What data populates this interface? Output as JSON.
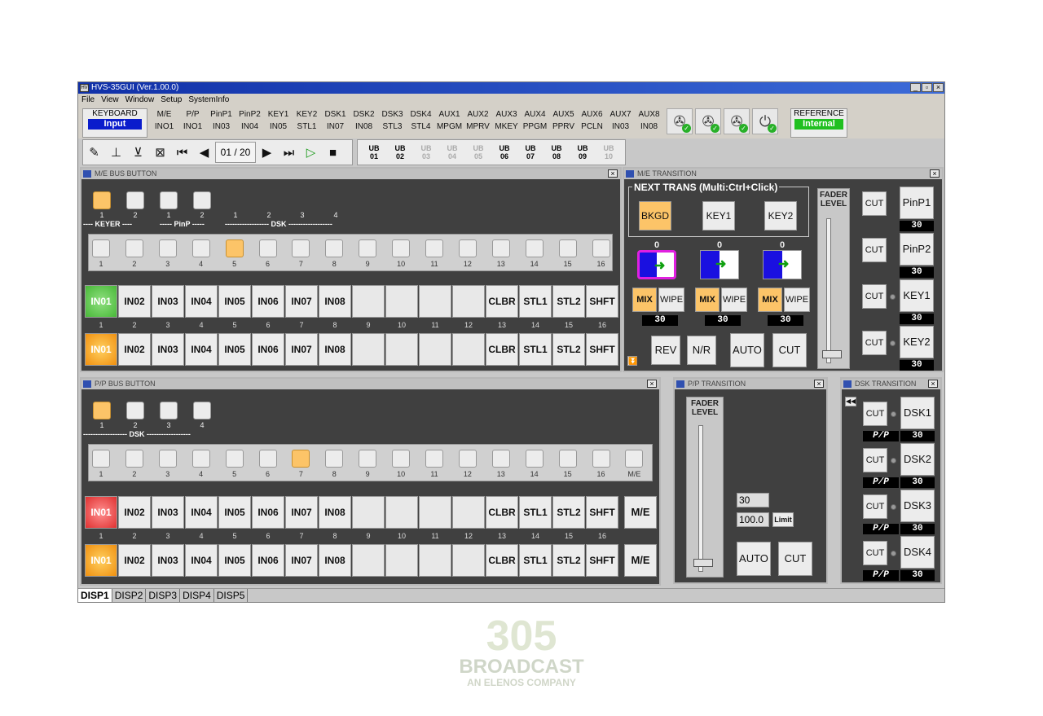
{
  "app": {
    "title": "HVS-35GUI (Ver.1.00.0)"
  },
  "menu": [
    "File",
    "View",
    "Window",
    "Setup",
    "SystemInfo"
  ],
  "keyboard": {
    "label": "KEYBOARD",
    "value": "Input"
  },
  "columns": [
    [
      "M/E",
      "INO1"
    ],
    [
      "P/P",
      "INO1"
    ],
    [
      "PinP1",
      "IN03"
    ],
    [
      "PinP2",
      "IN04"
    ],
    [
      "KEY1",
      "IN05"
    ],
    [
      "KEY2",
      "STL1"
    ],
    [
      "DSK1",
      "IN07"
    ],
    [
      "DSK2",
      "IN08"
    ],
    [
      "DSK3",
      "STL3"
    ],
    [
      "DSK4",
      "STL4"
    ],
    [
      "AUX1",
      "MPGM"
    ],
    [
      "AUX2",
      "MPRV"
    ],
    [
      "AUX3",
      "MKEY"
    ],
    [
      "AUX4",
      "PPGM"
    ],
    [
      "AUX5",
      "PPRV"
    ],
    [
      "AUX6",
      "PCLN"
    ],
    [
      "AUX7",
      "IN03"
    ],
    [
      "AUX8",
      "IN08"
    ]
  ],
  "status_icons": [
    "fan-icon",
    "fan-icon",
    "fan-icon",
    "power-icon"
  ],
  "reference": {
    "label": "REFERENCE",
    "value": "Internal"
  },
  "toolbar": {
    "counter": "01 / 20",
    "ub": [
      [
        "UB",
        "01",
        true
      ],
      [
        "UB",
        "02",
        true
      ],
      [
        "UB",
        "03",
        false
      ],
      [
        "UB",
        "04",
        false
      ],
      [
        "UB",
        "05",
        false
      ],
      [
        "UB",
        "06",
        true
      ],
      [
        "UB",
        "07",
        true
      ],
      [
        "UB",
        "08",
        true
      ],
      [
        "UB",
        "09",
        true
      ],
      [
        "UB",
        "10",
        false
      ]
    ]
  },
  "me_bus": {
    "title": "M/E BUS BUTTON",
    "keyer_nums": [
      "1",
      "2",
      "1",
      "2",
      "1",
      "2",
      "3",
      "4"
    ],
    "keyer_label": "---- KEYER ----",
    "pinp_label": "----- PinP -----",
    "dsk_label": "------------------ DSK ------------------",
    "xpt_nums": [
      "1",
      "2",
      "3",
      "4",
      "5",
      "6",
      "7",
      "8",
      "9",
      "10",
      "11",
      "12",
      "13",
      "14",
      "15",
      "16"
    ],
    "pgm": [
      "IN01",
      "IN02",
      "IN03",
      "IN04",
      "IN05",
      "IN06",
      "IN07",
      "IN08",
      "",
      "",
      "",
      "",
      "CLBR",
      "STL1",
      "STL2",
      "SHFT"
    ],
    "pst": [
      "IN01",
      "IN02",
      "IN03",
      "IN04",
      "IN05",
      "IN06",
      "IN07",
      "IN08",
      "",
      "",
      "",
      "",
      "CLBR",
      "STL1",
      "STL2",
      "SHFT"
    ]
  },
  "me_trans": {
    "title": "M/E TRANSITION",
    "next_trans": "NEXT TRANS (Multi:Ctrl+Click)",
    "next": [
      "BKGD",
      "KEY1",
      "KEY2"
    ],
    "counts": [
      "0",
      "0",
      "0"
    ],
    "mix": "MIX",
    "wipe": "WIPE",
    "rates": [
      "30",
      "30",
      "30"
    ],
    "bottom": [
      "REV",
      "N/R",
      "AUTO",
      "CUT"
    ],
    "fader": "FADER LEVEL",
    "keys": [
      [
        "CUT",
        "PinP1",
        "30"
      ],
      [
        "CUT",
        "PinP2",
        "30"
      ],
      [
        "CUT",
        "KEY1",
        "30"
      ],
      [
        "CUT",
        "KEY2",
        "30"
      ]
    ]
  },
  "pp_bus": {
    "title": "P/P BUS BUTTON",
    "dsk_nums": [
      "1",
      "2",
      "3",
      "4"
    ],
    "dsk_label": "------------------ DSK ------------------",
    "xpt_nums": [
      "1",
      "2",
      "3",
      "4",
      "5",
      "6",
      "7",
      "8",
      "9",
      "10",
      "11",
      "12",
      "13",
      "14",
      "15",
      "16",
      "M/E"
    ],
    "pgm": [
      "IN01",
      "IN02",
      "IN03",
      "IN04",
      "IN05",
      "IN06",
      "IN07",
      "IN08",
      "",
      "",
      "",
      "",
      "CLBR",
      "STL1",
      "STL2",
      "SHFT"
    ],
    "pst": [
      "IN01",
      "IN02",
      "IN03",
      "IN04",
      "IN05",
      "IN06",
      "IN07",
      "IN08",
      "",
      "",
      "",
      "",
      "CLBR",
      "STL1",
      "STL2",
      "SHFT"
    ],
    "me_label": "M/E"
  },
  "pp_trans": {
    "title": "P/P TRANSITION",
    "fader": "FADER LEVEL",
    "rate": "30",
    "level": "100.0",
    "limit": "Limit",
    "auto": "AUTO",
    "cut": "CUT"
  },
  "dsk_trans": {
    "title": "DSK TRANSITION",
    "rows": [
      [
        "CUT",
        "DSK1",
        "P/P",
        "30"
      ],
      [
        "CUT",
        "DSK2",
        "P/P",
        "30"
      ],
      [
        "CUT",
        "DSK3",
        "P/P",
        "30"
      ],
      [
        "CUT",
        "DSK4",
        "P/P",
        "30"
      ]
    ]
  },
  "tabs": [
    "DISP1",
    "DISP2",
    "DISP3",
    "DISP4",
    "DISP5"
  ],
  "watermark": {
    "big": "305",
    "mid": "BROADCAST",
    "sm": "AN ELENOS COMPANY"
  }
}
